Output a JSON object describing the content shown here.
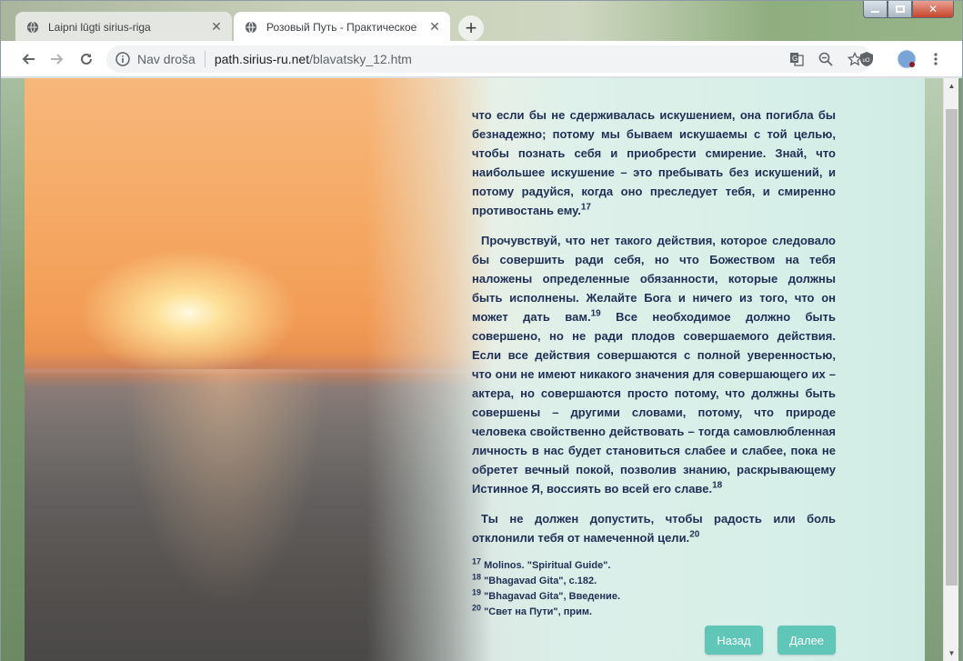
{
  "browser": {
    "tabs": [
      {
        "title": "Laipni lūgti sirius-riga",
        "active": false
      },
      {
        "title": "Розовый Путь - Практическое с",
        "active": true
      }
    ],
    "new_tab_label": "+",
    "security_label": "Nav droša",
    "url_host": "path.sirius-ru.net",
    "url_path": "/blavatsky_12.htm",
    "window_controls": {
      "minimize": "—",
      "maximize": "□",
      "close": "✕"
    }
  },
  "page": {
    "paragraphs": [
      {
        "text": "что если бы не сдерживалась искушением, она погибла бы безнадежно; потому мы бываем искушаемы с той целью, чтобы познать себя и приобрести смирение. Знай, что наибольшее искушение – это пребывать без искушений, и потому радуйся, когда оно преследует тебя, и смиренно противостань ему.",
        "note": "17"
      },
      {
        "text_a": "Прочувствуй, что нет такого действия, которое следовало бы совершить ради себя, но что Божеством на тебя наложены определенные обязанности, которые должны быть исполнены. Желайте Бога и ничего из того, что он может дать вам.",
        "note_a": "19",
        "text_b": " Все необходимое должно быть совершено, но не ради плодов совершаемого действия. Если все действия совершаются с полной уверенностью, что они не имеют никакого значения для совершающего их – актера, но совершаются просто потому, что должны быть совершены – другими словами, потому, что природе человека свойственно действовать – тогда самовлюбленная личность в нас будет становиться слабее и слабее, пока не обретет вечный покой, позволив знанию, раскрывающему Истинное Я, воссиять во всей его славе.",
        "note_b": "18"
      },
      {
        "text": "Ты не должен допустить, чтобы радость или боль отклонили тебя от намеченной цели.",
        "note": "20"
      }
    ],
    "footnotes": [
      {
        "num": "17",
        "text": " Molinos. \"Spiritual Guide\"."
      },
      {
        "num": "18",
        "text": " \"Bhagavad Gita\", с.182."
      },
      {
        "num": "19",
        "text": " \"Bhagavad Gita\", Введение."
      },
      {
        "num": "20",
        "text": " \"Свет на Пути\", прим."
      }
    ],
    "nav": {
      "back": "Назад",
      "next": "Далее"
    }
  },
  "colors": {
    "text": "#1f2f55",
    "button": "#5fc6b8",
    "panel": "#d6efe8"
  },
  "icons": [
    "globe-icon",
    "close-icon",
    "back-arrow-icon",
    "forward-arrow-icon",
    "reload-icon",
    "info-icon",
    "translate-icon",
    "zoom-out-icon",
    "star-icon",
    "shield-extension-icon",
    "profile-avatar",
    "menu-dots-icon"
  ]
}
